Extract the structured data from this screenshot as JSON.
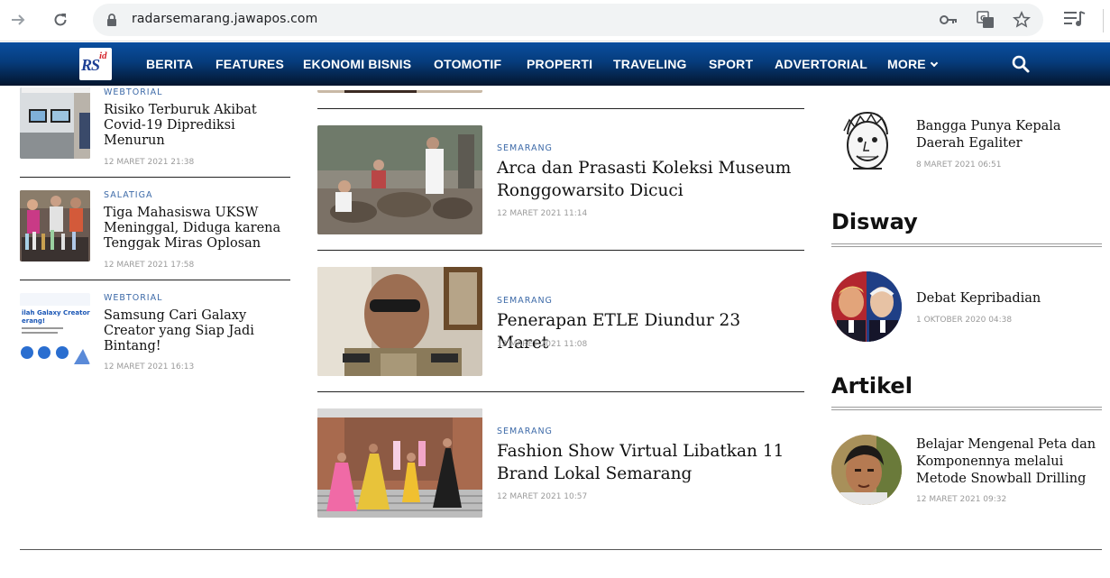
{
  "browser": {
    "url": "radarsemarang.jawapos.com",
    "back_icon": "arrow-right-icon",
    "reload_icon": "reload-icon"
  },
  "site": {
    "logo_main": "RS",
    "logo_sup": "id",
    "nav": [
      "BERITA",
      "FEATURES",
      "EKONOMI BISNIS",
      "OTOMOTIF",
      "PROPERTI",
      "TRAVELING",
      "SPORT",
      "ADVERTORIAL",
      "MORE"
    ],
    "colors": {
      "nav_top": "#0a4fa0",
      "nav_bottom": "#04152d",
      "category": "#3d6aa8"
    }
  },
  "left_list": [
    {
      "category": "WEBTORIAL",
      "title": "Risiko Terburuk Akibat Covid-19 Diprediksi Menurun",
      "date": "12 MARET 2021 21:38"
    },
    {
      "category": "SALATIGA",
      "title": "Tiga Mahasiswa UKSW Meninggal, Diduga karena Tenggak Miras Oplosan",
      "date": "12 MARET 2021 17:58"
    },
    {
      "category": "WEBTORIAL",
      "title": "Samsung Cari Galaxy Creator yang Siap Jadi Bintang!",
      "date": "12 MARET 2021 16:13"
    }
  ],
  "center_list": [
    {
      "category": "SEMARANG",
      "title": "Arca dan Prasasti Koleksi Museum Ronggowarsito Dicuci",
      "date": "12 MARET 2021 11:14"
    },
    {
      "category": "SEMARANG",
      "title": "Penerapan ETLE Diundur 23 Maret",
      "date": "12 MARET 2021 11:08"
    },
    {
      "category": "SEMARANG",
      "title": "Fashion Show Virtual Libatkan 11 Brand Lokal Semarang",
      "date": "12 MARET 2021 10:57"
    }
  ],
  "right": {
    "top_item": {
      "title": "Bangga Punya Kepala Daerah Egaliter",
      "date": "8 MARET 2021 06:51"
    },
    "disway": {
      "heading": "Disway",
      "title": "Debat Kepribadian",
      "date": "1 OKTOBER 2020 04:38"
    },
    "artikel": {
      "heading": "Artikel",
      "title": "Belajar Mengenal Peta dan Komponennya melalui Metode Snowball Drilling",
      "date": "12 MARET 2021 09:32"
    }
  },
  "promo_thumb_text": {
    "line1": "ilah Galaxy Creator",
    "line2": "erang!"
  }
}
